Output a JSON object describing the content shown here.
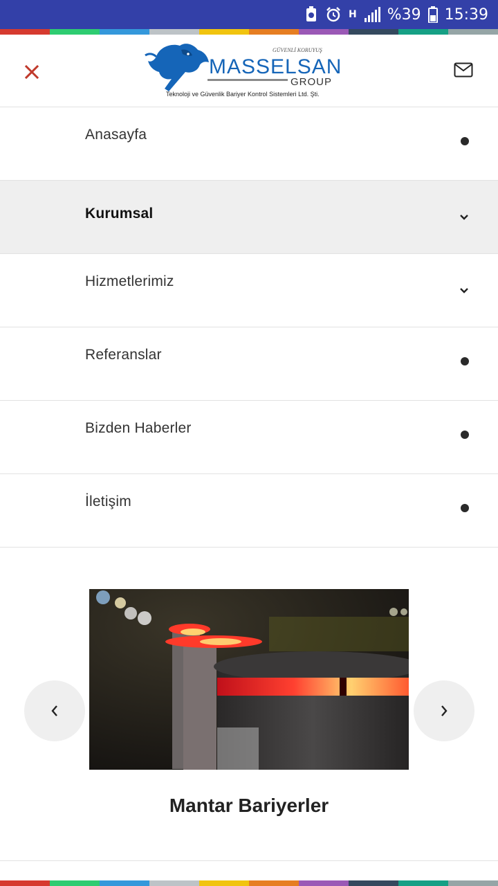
{
  "status_bar": {
    "battery": "%39",
    "time": "15:39",
    "network": "H"
  },
  "color_strip": [
    "#d63a2f",
    "#2ecc71",
    "#3498db",
    "#bdc3c7",
    "#f1c40f",
    "#e67e22",
    "#9b59b6",
    "#34495e",
    "#16a085",
    "#95a5a6"
  ],
  "header": {
    "logo": {
      "title": "MASSELSAN",
      "motto": "GÜVENLİ KORUYUŞ",
      "group": "GROUP",
      "subtitle": "Teknoloji ve Güvenlik Bariyer Kontrol Sistemleri Ltd. Şti."
    },
    "close_icon": "close-icon",
    "mail_icon": "mail-icon",
    "accent_color": "#c0392b",
    "brand_color": "#1565b8"
  },
  "menu": {
    "items": [
      {
        "label": "Anasayfa",
        "indicator": "dot"
      },
      {
        "label": "Kurumsal",
        "indicator": "chevron"
      },
      {
        "label": "Hizmetlerimiz",
        "indicator": "chevron"
      },
      {
        "label": "Referanslar",
        "indicator": "dot"
      },
      {
        "label": "Bizden Haberler",
        "indicator": "dot"
      },
      {
        "label": "İletişim",
        "indicator": "dot"
      }
    ],
    "active_index": 1
  },
  "slider": {
    "caption": "Mantar Bariyerler",
    "prev_icon": "chevron-left-icon",
    "next_icon": "chevron-right-icon"
  }
}
